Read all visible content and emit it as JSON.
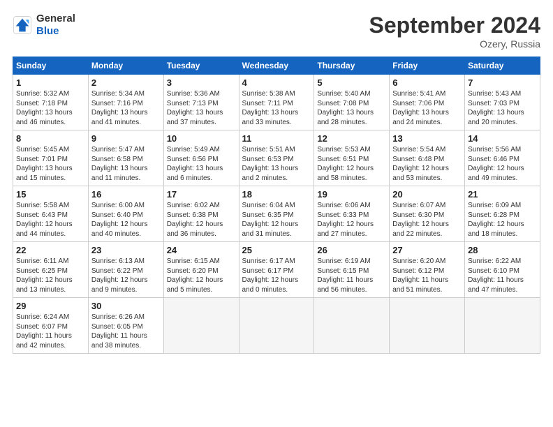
{
  "header": {
    "logo_general": "General",
    "logo_blue": "Blue",
    "title": "September 2024",
    "location": "Ozery, Russia"
  },
  "columns": [
    "Sunday",
    "Monday",
    "Tuesday",
    "Wednesday",
    "Thursday",
    "Friday",
    "Saturday"
  ],
  "weeks": [
    [
      {
        "day": "1",
        "lines": [
          "Sunrise: 5:32 AM",
          "Sunset: 7:18 PM",
          "Daylight: 13 hours",
          "and 46 minutes."
        ]
      },
      {
        "day": "2",
        "lines": [
          "Sunrise: 5:34 AM",
          "Sunset: 7:16 PM",
          "Daylight: 13 hours",
          "and 41 minutes."
        ]
      },
      {
        "day": "3",
        "lines": [
          "Sunrise: 5:36 AM",
          "Sunset: 7:13 PM",
          "Daylight: 13 hours",
          "and 37 minutes."
        ]
      },
      {
        "day": "4",
        "lines": [
          "Sunrise: 5:38 AM",
          "Sunset: 7:11 PM",
          "Daylight: 13 hours",
          "and 33 minutes."
        ]
      },
      {
        "day": "5",
        "lines": [
          "Sunrise: 5:40 AM",
          "Sunset: 7:08 PM",
          "Daylight: 13 hours",
          "and 28 minutes."
        ]
      },
      {
        "day": "6",
        "lines": [
          "Sunrise: 5:41 AM",
          "Sunset: 7:06 PM",
          "Daylight: 13 hours",
          "and 24 minutes."
        ]
      },
      {
        "day": "7",
        "lines": [
          "Sunrise: 5:43 AM",
          "Sunset: 7:03 PM",
          "Daylight: 13 hours",
          "and 20 minutes."
        ]
      }
    ],
    [
      {
        "day": "8",
        "lines": [
          "Sunrise: 5:45 AM",
          "Sunset: 7:01 PM",
          "Daylight: 13 hours",
          "and 15 minutes."
        ]
      },
      {
        "day": "9",
        "lines": [
          "Sunrise: 5:47 AM",
          "Sunset: 6:58 PM",
          "Daylight: 13 hours",
          "and 11 minutes."
        ]
      },
      {
        "day": "10",
        "lines": [
          "Sunrise: 5:49 AM",
          "Sunset: 6:56 PM",
          "Daylight: 13 hours",
          "and 6 minutes."
        ]
      },
      {
        "day": "11",
        "lines": [
          "Sunrise: 5:51 AM",
          "Sunset: 6:53 PM",
          "Daylight: 13 hours",
          "and 2 minutes."
        ]
      },
      {
        "day": "12",
        "lines": [
          "Sunrise: 5:53 AM",
          "Sunset: 6:51 PM",
          "Daylight: 12 hours",
          "and 58 minutes."
        ]
      },
      {
        "day": "13",
        "lines": [
          "Sunrise: 5:54 AM",
          "Sunset: 6:48 PM",
          "Daylight: 12 hours",
          "and 53 minutes."
        ]
      },
      {
        "day": "14",
        "lines": [
          "Sunrise: 5:56 AM",
          "Sunset: 6:46 PM",
          "Daylight: 12 hours",
          "and 49 minutes."
        ]
      }
    ],
    [
      {
        "day": "15",
        "lines": [
          "Sunrise: 5:58 AM",
          "Sunset: 6:43 PM",
          "Daylight: 12 hours",
          "and 44 minutes."
        ]
      },
      {
        "day": "16",
        "lines": [
          "Sunrise: 6:00 AM",
          "Sunset: 6:40 PM",
          "Daylight: 12 hours",
          "and 40 minutes."
        ]
      },
      {
        "day": "17",
        "lines": [
          "Sunrise: 6:02 AM",
          "Sunset: 6:38 PM",
          "Daylight: 12 hours",
          "and 36 minutes."
        ]
      },
      {
        "day": "18",
        "lines": [
          "Sunrise: 6:04 AM",
          "Sunset: 6:35 PM",
          "Daylight: 12 hours",
          "and 31 minutes."
        ]
      },
      {
        "day": "19",
        "lines": [
          "Sunrise: 6:06 AM",
          "Sunset: 6:33 PM",
          "Daylight: 12 hours",
          "and 27 minutes."
        ]
      },
      {
        "day": "20",
        "lines": [
          "Sunrise: 6:07 AM",
          "Sunset: 6:30 PM",
          "Daylight: 12 hours",
          "and 22 minutes."
        ]
      },
      {
        "day": "21",
        "lines": [
          "Sunrise: 6:09 AM",
          "Sunset: 6:28 PM",
          "Daylight: 12 hours",
          "and 18 minutes."
        ]
      }
    ],
    [
      {
        "day": "22",
        "lines": [
          "Sunrise: 6:11 AM",
          "Sunset: 6:25 PM",
          "Daylight: 12 hours",
          "and 13 minutes."
        ]
      },
      {
        "day": "23",
        "lines": [
          "Sunrise: 6:13 AM",
          "Sunset: 6:22 PM",
          "Daylight: 12 hours",
          "and 9 minutes."
        ]
      },
      {
        "day": "24",
        "lines": [
          "Sunrise: 6:15 AM",
          "Sunset: 6:20 PM",
          "Daylight: 12 hours",
          "and 5 minutes."
        ]
      },
      {
        "day": "25",
        "lines": [
          "Sunrise: 6:17 AM",
          "Sunset: 6:17 PM",
          "Daylight: 12 hours",
          "and 0 minutes."
        ]
      },
      {
        "day": "26",
        "lines": [
          "Sunrise: 6:19 AM",
          "Sunset: 6:15 PM",
          "Daylight: 11 hours",
          "and 56 minutes."
        ]
      },
      {
        "day": "27",
        "lines": [
          "Sunrise: 6:20 AM",
          "Sunset: 6:12 PM",
          "Daylight: 11 hours",
          "and 51 minutes."
        ]
      },
      {
        "day": "28",
        "lines": [
          "Sunrise: 6:22 AM",
          "Sunset: 6:10 PM",
          "Daylight: 11 hours",
          "and 47 minutes."
        ]
      }
    ],
    [
      {
        "day": "29",
        "lines": [
          "Sunrise: 6:24 AM",
          "Sunset: 6:07 PM",
          "Daylight: 11 hours",
          "and 42 minutes."
        ]
      },
      {
        "day": "30",
        "lines": [
          "Sunrise: 6:26 AM",
          "Sunset: 6:05 PM",
          "Daylight: 11 hours",
          "and 38 minutes."
        ]
      },
      null,
      null,
      null,
      null,
      null
    ]
  ]
}
